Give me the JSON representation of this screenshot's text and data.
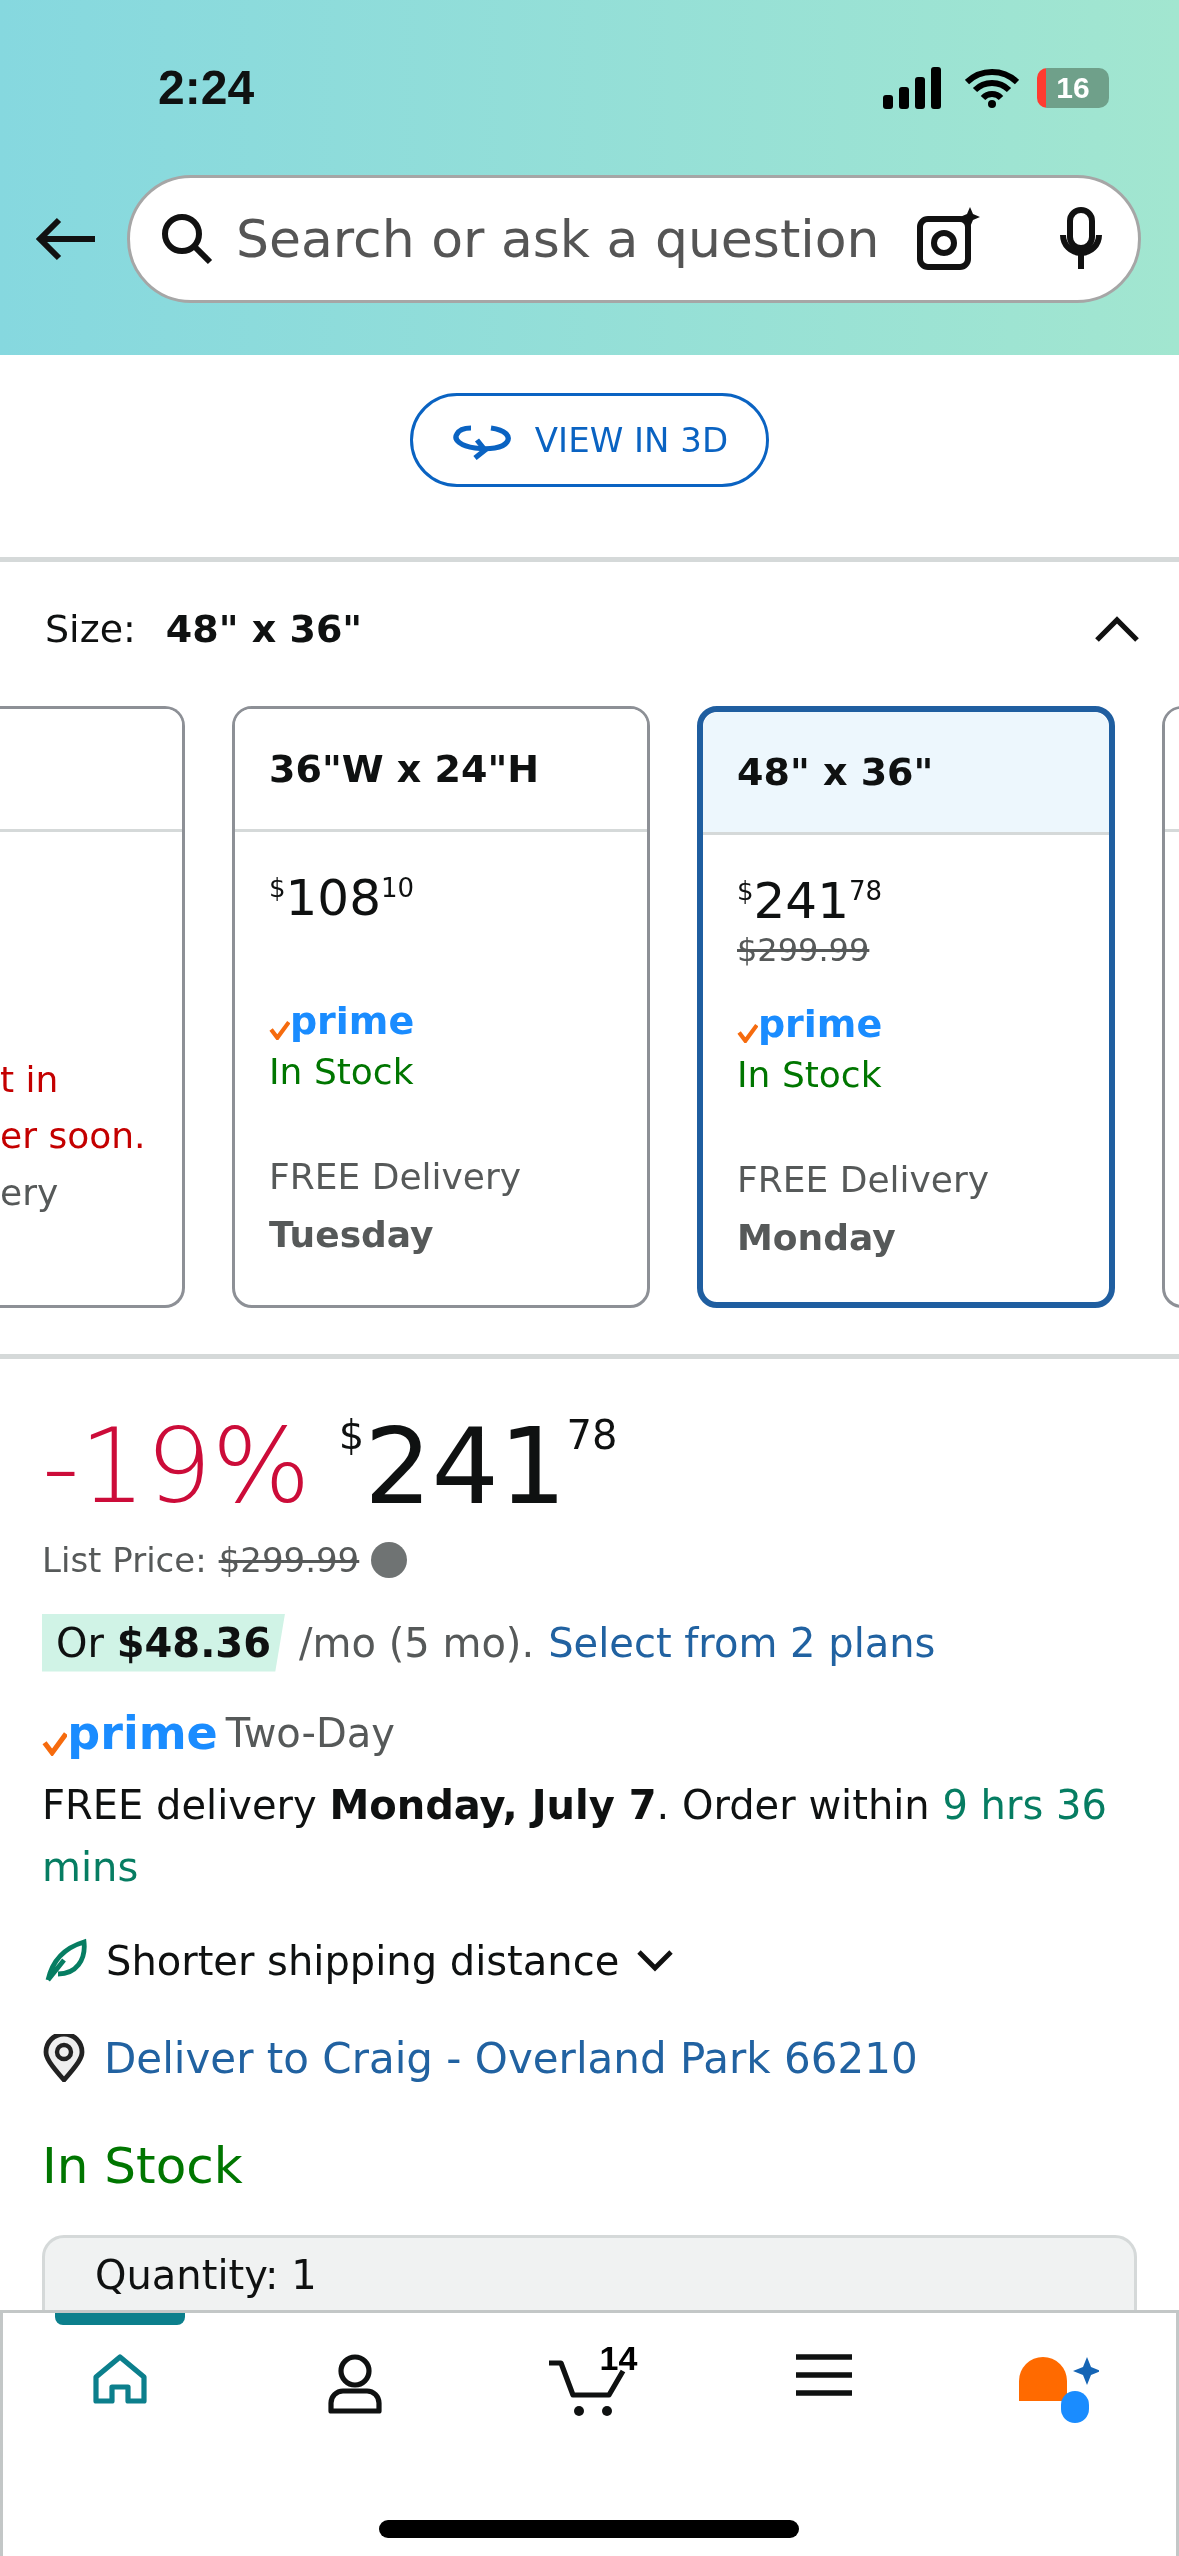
{
  "status_bar": {
    "time": "2:24",
    "battery": "16"
  },
  "search": {
    "placeholder": "Search or ask a question"
  },
  "view_3d_button": "VIEW IN 3D",
  "size_selector": {
    "label": "Size:",
    "value": "48\" x 36\"",
    "expanded": true
  },
  "size_cards": [
    {
      "kind": "partial",
      "selected": false,
      "lines": [
        {
          "text": "t in",
          "kind": "alert"
        },
        {
          "text": "er soon.",
          "kind": "alert"
        },
        {
          "text": "ery",
          "kind": "note"
        }
      ]
    },
    {
      "kind": "full",
      "selected": false,
      "header": "36\"W x 24\"H",
      "price": {
        "currency": "$",
        "whole": "108",
        "fraction": "10"
      },
      "prime": "prime",
      "stock": "In Stock",
      "delivery": "FREE Delivery",
      "delivery_day": "Tuesday"
    },
    {
      "kind": "full",
      "selected": true,
      "header": "48\" x 36\"",
      "price": {
        "currency": "$",
        "whole": "241",
        "fraction": "78"
      },
      "list_price": "$299.99",
      "prime": "prime",
      "stock": "In Stock",
      "delivery": "FREE Delivery",
      "delivery_day": "Monday"
    },
    {
      "kind": "edge",
      "selected": false
    }
  ],
  "price": {
    "discount": "-19%",
    "currency": "$",
    "whole": "241",
    "fraction": "78"
  },
  "list_price": {
    "label": "List Price:",
    "value": "$299.99"
  },
  "installment": {
    "offer": "Or **$48.36**",
    "terms": "/mo (5 mo).",
    "link": "Select from 2 plans"
  },
  "prime_delivery": {
    "logo": "prime",
    "speed": "Two-Day"
  },
  "delivery": {
    "text": "FREE delivery **Monday, July 7**. Order within",
    "countdown": "9 hrs 36 mins"
  },
  "shipping_note": {
    "text": "Shorter shipping distance",
    "expanded": false
  },
  "deliver_to": "Deliver to Craig - Overland Park 66210",
  "availability": "In Stock",
  "quantity": "Quantity: 1",
  "nav": [
    {
      "kind": "home",
      "selected": true
    },
    {
      "kind": "account",
      "selected": false
    },
    {
      "kind": "cart",
      "selected": false,
      "badge": "14"
    },
    {
      "kind": "menu",
      "selected": false
    },
    {
      "kind": "assistant",
      "selected": false
    }
  ]
}
